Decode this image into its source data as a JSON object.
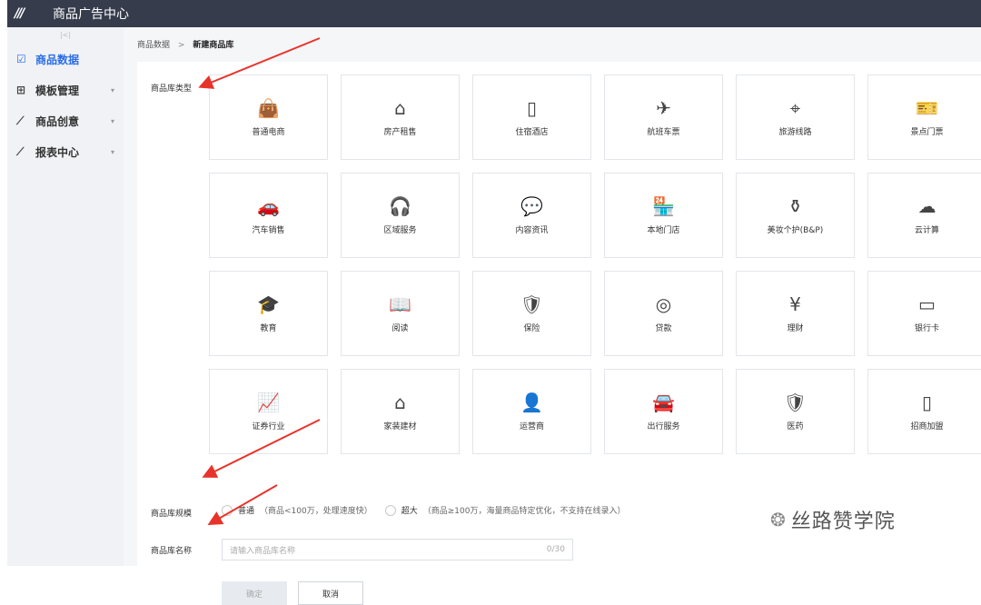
{
  "header": {
    "logo": "///",
    "title": "商品广告中心"
  },
  "sidebar": {
    "collapse": "|<|",
    "items": [
      {
        "icon": "☑",
        "label": "商品数据"
      },
      {
        "icon": "⊞",
        "label": "模板管理",
        "chevron": "▾"
      },
      {
        "icon": "⟋",
        "label": "商品创意",
        "chevron": "▾"
      },
      {
        "icon": "⟋",
        "label": "报表中心",
        "chevron": "▾"
      }
    ]
  },
  "breadcrumb": {
    "parent": "商品数据",
    "sep": ">",
    "current": "新建商品库"
  },
  "form": {
    "type_label": "商品库类型",
    "scale_label": "商品库规模",
    "name_label": "商品库名称",
    "types": [
      {
        "icon": "👜",
        "label": "普通电商"
      },
      {
        "icon": "⌂",
        "label": "房产租售"
      },
      {
        "icon": "▯",
        "label": "住宿酒店"
      },
      {
        "icon": "✈",
        "label": "航班车票"
      },
      {
        "icon": "⌖",
        "label": "旅游线路"
      },
      {
        "icon": "🎫",
        "label": "景点门票"
      },
      {
        "icon": "🚗",
        "label": "汽车销售"
      },
      {
        "icon": "🎧",
        "label": "区域服务"
      },
      {
        "icon": "💬",
        "label": "内容资讯"
      },
      {
        "icon": "🏪",
        "label": "本地门店"
      },
      {
        "icon": "⚱",
        "label": "美妆个护(B&P)"
      },
      {
        "icon": "☁",
        "label": "云计算"
      },
      {
        "icon": "🎓",
        "label": "教育"
      },
      {
        "icon": "📖",
        "label": "阅读"
      },
      {
        "icon": "🛡",
        "label": "保险"
      },
      {
        "icon": "◎",
        "label": "贷款"
      },
      {
        "icon": "¥",
        "label": "理财"
      },
      {
        "icon": "▭",
        "label": "银行卡"
      },
      {
        "icon": "📈",
        "label": "证券行业"
      },
      {
        "icon": "⌂",
        "label": "家装建材"
      },
      {
        "icon": "👤",
        "label": "运营商"
      },
      {
        "icon": "🚘",
        "label": "出行服务"
      },
      {
        "icon": "🛡",
        "label": "医药"
      },
      {
        "icon": "▯",
        "label": "招商加盟"
      }
    ],
    "scale_options": [
      {
        "label": "普通",
        "hint": "（商品<100万，处理速度快）"
      },
      {
        "label": "超大",
        "hint": "（商品≥100万，海量商品特定优化，不支持在线录入）"
      }
    ],
    "name_placeholder": "请输入商品库名称",
    "name_counter": "0/30",
    "confirm": "确定",
    "cancel": "取消"
  },
  "watermark": {
    "icon": "❂",
    "text": "丝路赞学院"
  },
  "colors": {
    "accent": "#2a6ce6",
    "header_bg": "#363c4c",
    "arrow": "#e8332a"
  }
}
